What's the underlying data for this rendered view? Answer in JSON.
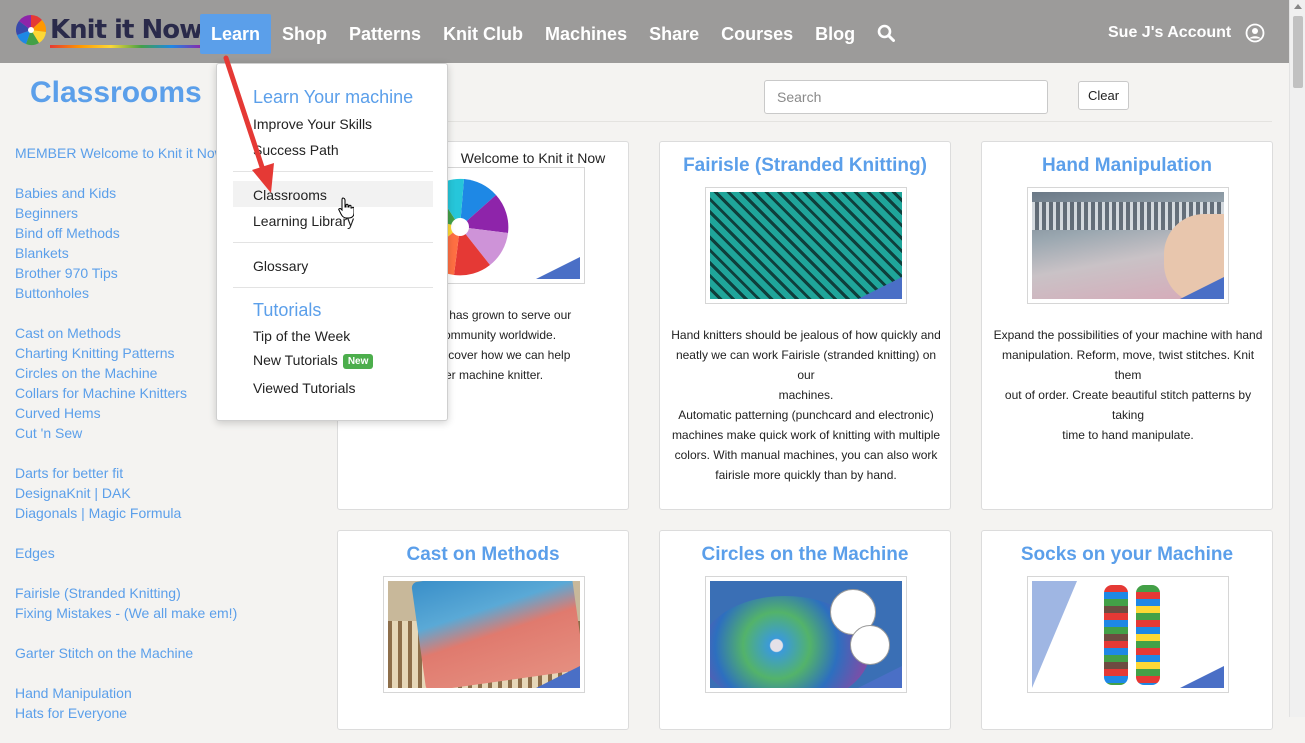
{
  "header": {
    "logo_text": "Knit it Now",
    "nav": [
      "Learn",
      "Shop",
      "Patterns",
      "Knit Club",
      "Machines",
      "Share",
      "Courses",
      "Blog"
    ],
    "active_nav": "Learn",
    "account_label": "Sue J's Account",
    "search_icon": "search-icon",
    "account_icon": "user-circle-icon"
  },
  "page": {
    "title": "Classrooms",
    "search_placeholder": "Search",
    "clear_label": "Clear"
  },
  "sidebar": {
    "groups": [
      [
        "MEMBER Welcome to Knit it Now"
      ],
      [
        "Babies and Kids",
        "Beginners",
        "Bind off Methods",
        "Blankets",
        "Brother 970 Tips",
        "Buttonholes"
      ],
      [
        "Cast on Methods",
        "Charting Knitting Patterns",
        "Circles on the Machine",
        "Collars for Machine Knitters",
        "Curved Hems",
        "Cut 'n Sew"
      ],
      [
        "Darts for better fit",
        "DesignaKnit | DAK",
        "Diagonals | Magic Formula"
      ],
      [
        "Edges"
      ],
      [
        "Fairisle (Stranded Knitting)",
        "Fixing Mistakes - (We all make em!)"
      ],
      [
        "Garter Stitch on the Machine"
      ],
      [
        "Hand Manipulation",
        "Hats for Everyone"
      ]
    ]
  },
  "cards": [
    {
      "title": "Welcome to Knit it Now",
      "desc": [
        "! The site has grown to serve our",
        "tting community worldwide.",
        "w and discover how we can help",
        "better machine knitter."
      ]
    },
    {
      "title": "Fairisle (Stranded Knitting)",
      "desc": [
        "Hand knitters should be jealous of how quickly and",
        "neatly we can work Fairisle (stranded knitting) on our",
        "machines.",
        "Automatic patterning (punchcard and electronic)",
        "machines make quick work of knitting with multiple",
        "colors. With manual machines, you can also work",
        "fairisle more quickly than by hand."
      ]
    },
    {
      "title": "Hand Manipulation",
      "desc": [
        "Expand the possibilities of your machine with hand",
        "manipulation. Reform, move, twist stitches. Knit them",
        "out of order. Create beautiful stitch patterns by taking",
        "time to hand manipulate."
      ]
    },
    {
      "title": "Cast on Methods",
      "desc": []
    },
    {
      "title": "Circles on the Machine",
      "desc": []
    },
    {
      "title": "Socks on your Machine",
      "desc": []
    }
  ],
  "learn_menu": {
    "heading_1": "Learn Your machine",
    "items_1": [
      "Improve Your Skills",
      "Success Path"
    ],
    "items_2": [
      "Classrooms",
      "Learning Library"
    ],
    "items_3": [
      "Glossary"
    ],
    "heading_2": "Tutorials",
    "items_4": [
      "Tip of the Week",
      "New Tutorials",
      "Viewed Tutorials"
    ],
    "new_badge": "New",
    "highlighted": "Classrooms"
  },
  "colors": {
    "accent": "#5b9fea",
    "header_bg": "#9c9b9a",
    "badge_green": "#4cae4c",
    "arrow_red": "#e53935"
  }
}
